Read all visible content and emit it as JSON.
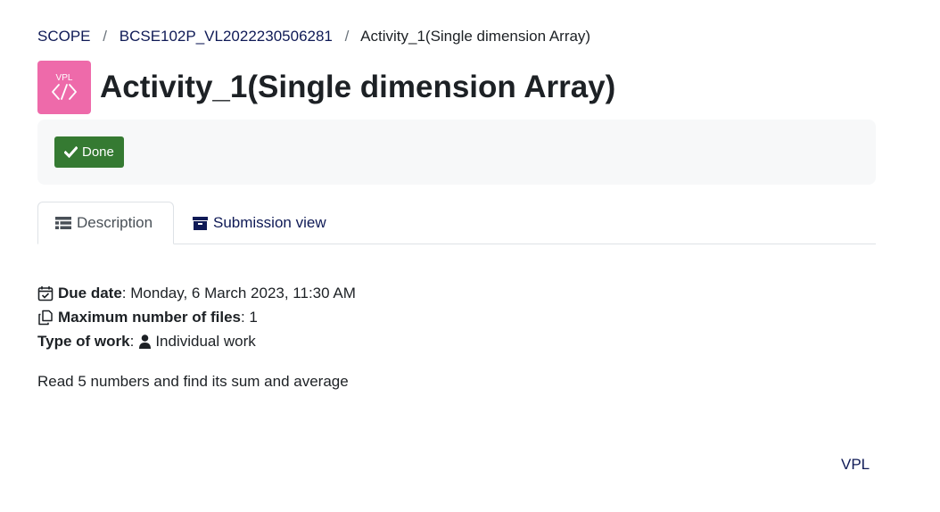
{
  "breadcrumb": {
    "items": [
      "SCOPE",
      "BCSE102P_VL2022230506281"
    ],
    "current": "Activity_1(Single dimension Array)",
    "separator": "/"
  },
  "module_icon": {
    "label": "VPL",
    "glyph": "code-brackets-icon",
    "color": "#ee6aaa"
  },
  "page_title": "Activity_1(Single dimension Array)",
  "completion": {
    "done_label": "Done",
    "done_color": "#357a32",
    "icon": "check-icon"
  },
  "tabs": [
    {
      "label": "Description",
      "icon": "list-icon",
      "active": true
    },
    {
      "label": "Submission view",
      "icon": "archive-icon",
      "active": false
    }
  ],
  "details": {
    "due_date": {
      "label": "Due date",
      "value": ": Monday, 6 March 2023, 11:30 AM",
      "icon": "calendar-check-icon"
    },
    "max_files": {
      "label": "Maximum number of files",
      "value": ": 1",
      "icon": "copy-files-icon"
    },
    "work_type": {
      "label": "Type of work",
      "sep": ":",
      "value": "Individual work",
      "icon": "user-icon"
    }
  },
  "intro_text": "Read 5 numbers and find its sum and average",
  "footer_link": "VPL",
  "colors": {
    "link": "#0f1a56",
    "text": "#1d2125",
    "box_bg": "#f7f8f9"
  }
}
